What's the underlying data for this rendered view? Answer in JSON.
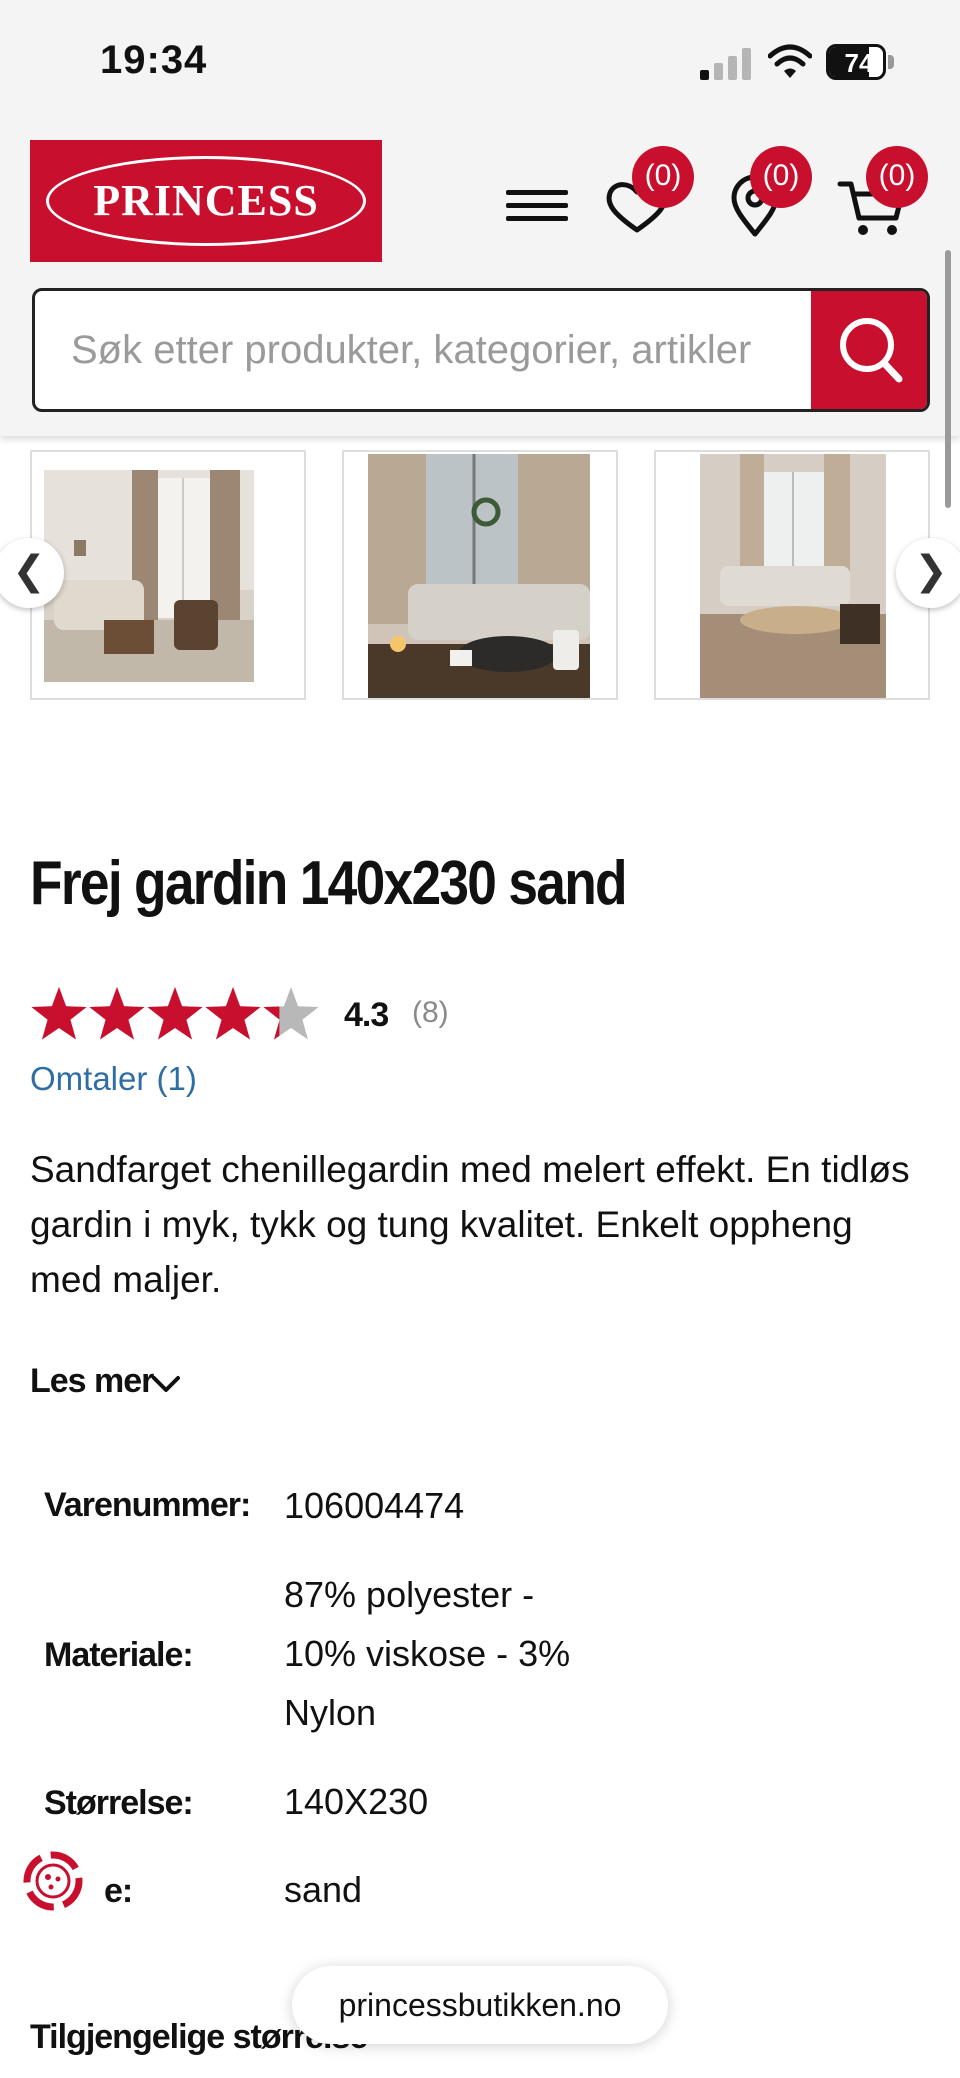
{
  "status_bar": {
    "time": "19:34",
    "battery": "74"
  },
  "header": {
    "logo_text": "PRINCESS",
    "wishlist_count": "(0)",
    "stores_count": "(0)",
    "cart_count": "(0)",
    "search_placeholder": "Søk etter produkter, kategorier, artikler"
  },
  "gallery": {
    "prev_label": "❮",
    "next_label": "❯",
    "images": [
      "living-room-curtains",
      "sofa-with-wreath-window",
      "living-room-round-table"
    ]
  },
  "product": {
    "title": "Frej gardin 140x230 sand",
    "rating": "4.3",
    "rating_count": "(8)",
    "rating_value": 4.3,
    "reviews_link": "Omtaler (1)",
    "description": "Sandfarget chenillegardin med melert effekt. En tidløs gardin i myk, tykk og tung kvalitet. Enkelt oppheng med maljer.",
    "read_more": "Les mer"
  },
  "specs": [
    {
      "label": "Varenummer:",
      "value": "106004474"
    },
    {
      "label": "Materiale:",
      "value_lines": [
        "87% polyester -",
        "10% viskose - 3%",
        "Nylon"
      ]
    },
    {
      "label": "Størrelse:",
      "value": "140X230"
    },
    {
      "label": "e:",
      "value": "sand"
    }
  ],
  "available_sizes_heading": "Tilgjengelige størrelse",
  "url_bar": "princessbutikken.no",
  "colors": {
    "brand": "#c8102e",
    "link": "#2f6ea5",
    "star_empty": "#b8b8b8"
  }
}
